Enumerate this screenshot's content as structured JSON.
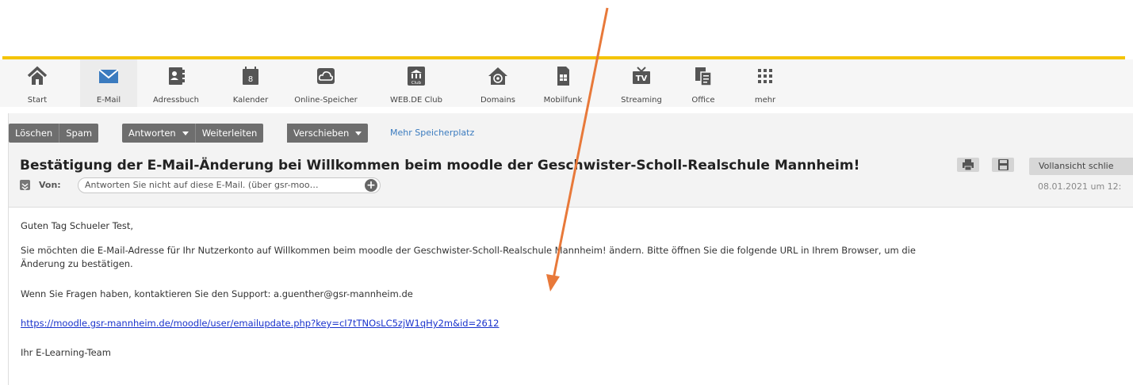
{
  "nav": [
    {
      "label": "Start",
      "icon": "home-icon"
    },
    {
      "label": "E-Mail",
      "icon": "mail-icon",
      "active": true
    },
    {
      "label": "Adressbuch",
      "icon": "addressbook-icon"
    },
    {
      "label": "Kalender",
      "icon": "calendar-icon",
      "day": "8"
    },
    {
      "label": "Online-Speicher",
      "icon": "cloud-icon"
    },
    {
      "label": "WEB.DE Club",
      "icon": "club-icon",
      "badge": "Club"
    },
    {
      "label": "Domains",
      "icon": "domains-icon"
    },
    {
      "label": "Mobilfunk",
      "icon": "mobile-icon"
    },
    {
      "label": "Streaming",
      "icon": "tv-icon",
      "badge": "TV"
    },
    {
      "label": "Office",
      "icon": "office-icon"
    },
    {
      "label": "mehr",
      "icon": "grid-icon"
    }
  ],
  "toolbar": {
    "delete_label": "Löschen",
    "spam_label": "Spam",
    "reply_label": "Antworten",
    "forward_label": "Weiterleiten",
    "move_label": "Verschieben",
    "storage_link": "Mehr Speicherplatz"
  },
  "mail": {
    "subject": "Bestätigung der E-Mail-Änderung bei Willkommen beim moodle der Geschwister-Scholl-Realschule Mannheim!",
    "close_full_view": "Vollansicht schlie",
    "from_label": "Von:",
    "from_value": "Antworten Sie nicht auf diese E-Mail. (über gsr-moo…",
    "date": "08.01.2021 um 12:",
    "body": {
      "greeting": "Guten Tag Schueler Test,",
      "para1_line1": "Sie möchten die E-Mail-Adresse für Ihr Nutzerkonto auf Willkommen beim moodle der Geschwister-Scholl-Realschule Mannheim! ändern. Bitte öffnen Sie die folgende URL in Ihrem Browser, um die",
      "para1_line2": "Änderung zu bestätigen.",
      "support": "Wenn Sie Fragen haben, kontaktieren Sie den Support: a.guenther@gsr-mannheim.de",
      "link": "https://moodle.gsr-mannheim.de/moodle/user/emailupdate.php?key=cI7tTNOsLC5zjW1qHy2m&id=2612",
      "signature": "Ihr E-Learning-Team"
    }
  },
  "colors": {
    "accent_yellow": "#f4c400",
    "mail_blue": "#3b7bbf",
    "toolbar_grey": "#6e6e6e",
    "annotation_arrow": "#e8793a",
    "link_blue": "#1a33cc"
  }
}
